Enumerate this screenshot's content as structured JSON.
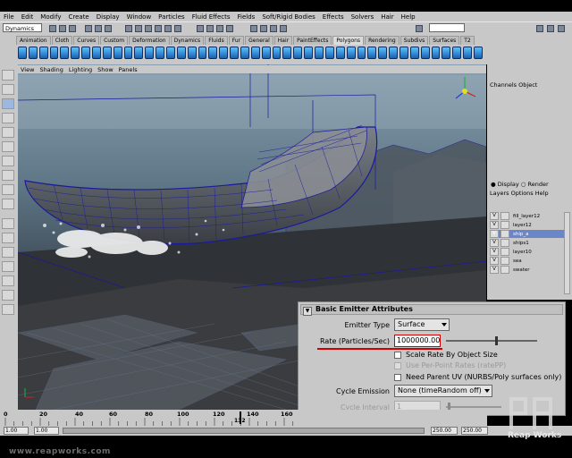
{
  "menu": [
    "File",
    "Edit",
    "Modify",
    "Create",
    "Display",
    "Window",
    "Particles",
    "Fluid Effects",
    "Fields",
    "Soft/Rigid Bodies",
    "Effects",
    "Solvers",
    "Hair",
    "Help"
  ],
  "status": {
    "mode": "Dynamics"
  },
  "shelf_tabs": [
    "Animation",
    "Cloth",
    "Curves",
    "Custom",
    "Deformation",
    "Dynamics",
    "Fluids",
    "Fur",
    "General",
    "Hair",
    "PaintEffects",
    "Polygons",
    "Rendering",
    "Subdivs",
    "Surfaces",
    "T2"
  ],
  "shelf_active": "Polygons",
  "viewport_menu": [
    "View",
    "Shading",
    "Lighting",
    "Show",
    "Panels"
  ],
  "channel_box": {
    "tabs": [
      "Channels",
      "Object"
    ]
  },
  "layers": {
    "display_label": "Display",
    "render_label": "Render",
    "menu": [
      "Layers",
      "Options",
      "Help"
    ],
    "rows": [
      {
        "name": "fill_layer12",
        "selected": false
      },
      {
        "name": "layer12",
        "selected": false
      },
      {
        "name": "ship_a",
        "selected": true
      },
      {
        "name": "ships1",
        "selected": false
      },
      {
        "name": "layer10",
        "selected": false
      },
      {
        "name": "sea",
        "selected": false
      },
      {
        "name": "swater",
        "selected": false
      }
    ]
  },
  "attribute_editor": {
    "section_title": "Basic Emitter Attributes",
    "emitter_type_label": "Emitter Type",
    "emitter_type_value": "Surface",
    "rate_label": "Rate (Particles/Sec)",
    "rate_value": "1000000.000",
    "rate_slider_fraction": 0.55,
    "scale_rate_label": "Scale Rate By Object Size",
    "use_per_point_label": "Use Per-Point Rates (ratePP)",
    "need_parent_uv_label": "Need Parent UV (NURBS/Poly surfaces only)",
    "cycle_emission_label": "Cycle Emission",
    "cycle_emission_value": "None (timeRandom off)",
    "cycle_interval_label": "Cycle Interval",
    "cycle_interval_value": "1"
  },
  "timeline": {
    "ticks": [
      "0",
      "20",
      "40",
      "60",
      "80",
      "100",
      "120",
      "140",
      "160"
    ],
    "current_frame": "132",
    "range": {
      "start": "1.00",
      "inner_start": "1.00",
      "inner_end": "250.00",
      "end": "250.00"
    }
  },
  "watermark": "www.reapworks.com",
  "brand": "Reap Works",
  "colors": {
    "ui_gray": "#c8c8c8",
    "highlight_red": "#d00000",
    "wire_blue": "#1a1a9c",
    "selected_layer": "#6a86c8"
  }
}
